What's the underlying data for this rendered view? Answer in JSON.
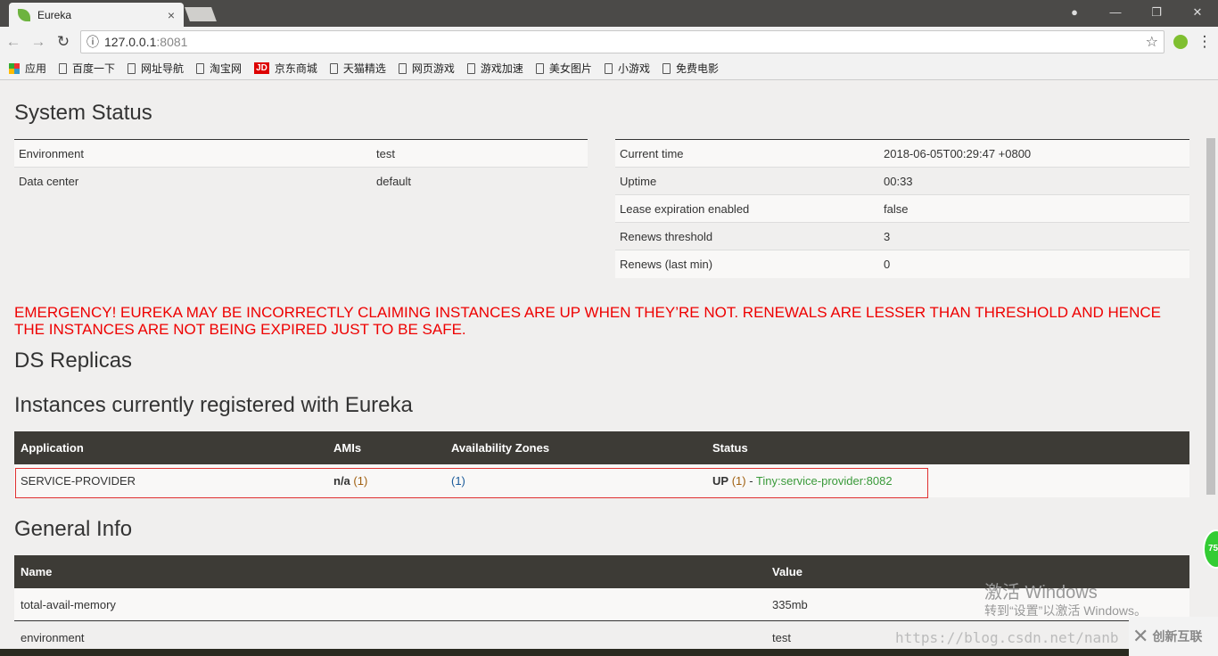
{
  "browser": {
    "tab_title": "Eureka",
    "tab_close": "×",
    "url_host": "127.0.0.1",
    "url_port": ":8081",
    "bookmarks": [
      "应用",
      "百度一下",
      "网址导航",
      "淘宝网",
      "京东商城",
      "天猫精选",
      "网页游戏",
      "游戏加速",
      "美女图片",
      "小游戏",
      "免费电影"
    ],
    "jd_badge": "JD"
  },
  "system_status": {
    "title": "System Status",
    "left": [
      {
        "k": "Environment",
        "v": "test"
      },
      {
        "k": "Data center",
        "v": "default"
      }
    ],
    "right": [
      {
        "k": "Current time",
        "v": "2018-06-05T00:29:47 +0800"
      },
      {
        "k": "Uptime",
        "v": "00:33"
      },
      {
        "k": "Lease expiration enabled",
        "v": "false"
      },
      {
        "k": "Renews threshold",
        "v": "3"
      },
      {
        "k": "Renews (last min)",
        "v": "0"
      }
    ]
  },
  "emergency": "EMERGENCY! EUREKA MAY BE INCORRECTLY CLAIMING INSTANCES ARE UP WHEN THEY’RE NOT. RENEWALS ARE LESSER THAN THRESHOLD AND HENCE THE INSTANCES ARE NOT BEING EXPIRED JUST TO BE SAFE.",
  "ds_replicas": "DS Replicas",
  "instances": {
    "title": "Instances currently registered with Eureka",
    "headers": [
      "Application",
      "AMIs",
      "Availability Zones",
      "Status"
    ],
    "rows": [
      {
        "app": "SERVICE-PROVIDER",
        "ami": "n/a",
        "ami_count": "(1)",
        "zones": "(1)",
        "status": "UP",
        "status_count": "(1)",
        "sep": " - ",
        "link": "Tiny:service-provider:8082"
      }
    ]
  },
  "general_info": {
    "title": "General Info",
    "headers": [
      "Name",
      "Value"
    ],
    "rows": [
      {
        "k": "total-avail-memory",
        "v": "335mb"
      },
      {
        "k": "environment",
        "v": "test"
      }
    ]
  },
  "overlay": {
    "win1": "激活 Windows",
    "win2": "转到“设置”以激活 Windows。",
    "csdn": "https://blog.csdn.net/nanb",
    "logo": "创新互联",
    "badge": "75"
  }
}
